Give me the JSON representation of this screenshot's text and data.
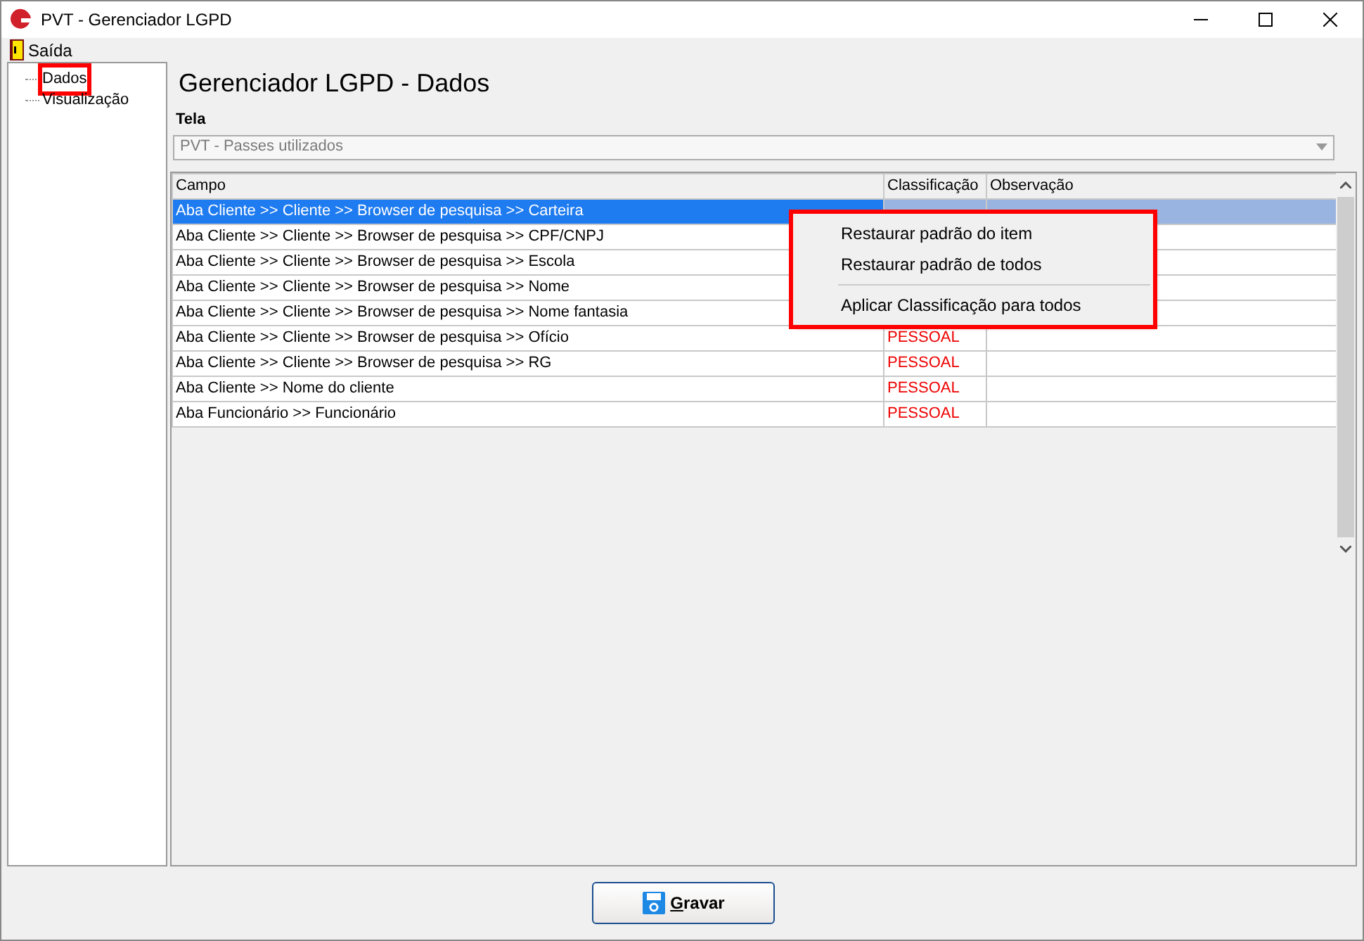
{
  "window": {
    "title": "PVT - Gerenciador LGPD"
  },
  "menu": [
    "Saída"
  ],
  "tree": [
    {
      "label": "Dados",
      "highlighted": true
    },
    {
      "label": "Visualização",
      "highlighted": false
    }
  ],
  "heading": "Gerenciador LGPD - Dados",
  "screen_field": {
    "label": "Tela",
    "value": "PVT - Passes utilizados",
    "disabled": true
  },
  "table": {
    "columns": [
      "Campo",
      "Classificação",
      "Observação"
    ],
    "rows": [
      {
        "campo": "Aba Cliente >> Cliente >> Browser de pesquisa >> Carteira",
        "selected": true
      },
      {
        "campo": "Aba Cliente >> Cliente >> Browser de pesquisa >> CPF/CNPJ",
        "selected": false
      },
      {
        "campo": "Aba Cliente >> Cliente >> Browser de pesquisa >> Escola",
        "selected": false
      },
      {
        "campo": "Aba Cliente >> Cliente >> Browser de pesquisa >> Nome",
        "selected": false
      },
      {
        "campo": "Aba Cliente >> Cliente >> Browser de pesquisa >> Nome fantasia",
        "selected": false
      },
      {
        "campo": "Aba Cliente >> Cliente >> Browser de pesquisa >> Ofício",
        "classificacao": "PESSOAL",
        "selected": false
      },
      {
        "campo": "Aba Cliente >> Cliente >> Browser de pesquisa >> RG",
        "classificacao": "PESSOAL",
        "selected": false
      },
      {
        "campo": "Aba Cliente >> Nome do cliente",
        "classificacao": "PESSOAL",
        "selected": false
      },
      {
        "campo": "Aba Funcionário >> Funcionário",
        "classificacao": "PESSOAL",
        "selected": false
      }
    ]
  },
  "context_menu": {
    "highlighted": true,
    "items": [
      {
        "kind": "item",
        "label": "Restaurar padrão do item"
      },
      {
        "kind": "item",
        "label": "Restaurar padrão de todos"
      },
      {
        "kind": "separator"
      },
      {
        "kind": "item",
        "label": "Aplicar Classificação para todos"
      }
    ]
  },
  "save_button": {
    "label": "Gravar"
  }
}
